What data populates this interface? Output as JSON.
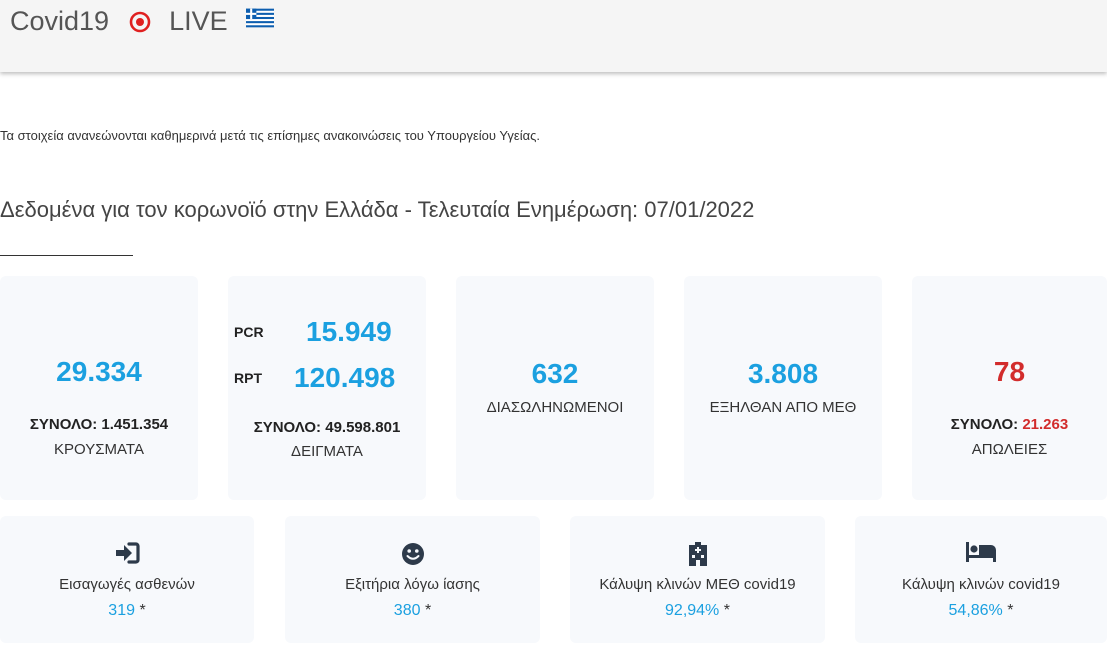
{
  "header": {
    "brand": "Covid19",
    "live": "LIVE"
  },
  "notice": "Τα στοιχεία ανανεώνονται καθημερινά μετά τις επίσημες ανακοινώσεις του Υπουργείου Υγείας.",
  "title": "Δεδομένα για τον κορωνοϊό στην Ελλάδα - Τελευταία Ενημέρωση: 07/01/2022",
  "cards": {
    "cases": {
      "value": "29.334",
      "total": "ΣΥΝΟΛΟ: 1.451.354",
      "label": "ΚΡΟΥΣΜΑΤΑ"
    },
    "tests": {
      "pcr_tag": "PCR",
      "pcr_value": "15.949",
      "rpt_tag": "RPT",
      "rpt_value": "120.498",
      "total": "ΣΥΝΟΛΟ: 49.598.801",
      "label": "ΔΕΙΓΜΑΤΑ"
    },
    "intubated": {
      "value": "632",
      "label": "ΔΙΑΣΩΛΗΝΩΜΕΝΟΙ"
    },
    "icu_exits": {
      "value": "3.808",
      "label": "ΕΞΗΛΘΑΝ ΑΠΟ ΜΕΘ"
    },
    "deaths": {
      "value": "78",
      "total_prefix": "ΣΥΝΟΛΟ:",
      "total_value": "21.263",
      "label": "ΑΠΩΛΕΙΕΣ"
    }
  },
  "bottom": {
    "admissions": {
      "label": "Εισαγωγές ασθενών",
      "value": "319",
      "star": "*",
      "icon": "sign-in-icon"
    },
    "discharges": {
      "label": "Εξιτήρια λόγω ίασης",
      "value": "380",
      "star": "*",
      "icon": "smile-icon"
    },
    "icu_beds": {
      "label": "Κάλυψη κλινών ΜΕΘ covid19",
      "value": "92,94%",
      "star": "*",
      "icon": "hospital-icon"
    },
    "covid_beds": {
      "label": "Κάλυψη κλινών covid19",
      "value": "54,86%",
      "star": "*",
      "icon": "bed-icon"
    }
  },
  "colors": {
    "accent": "#1ba0e0",
    "danger": "#d22c2c",
    "live": "#e02020",
    "card_bg": "#f7f9fc"
  }
}
